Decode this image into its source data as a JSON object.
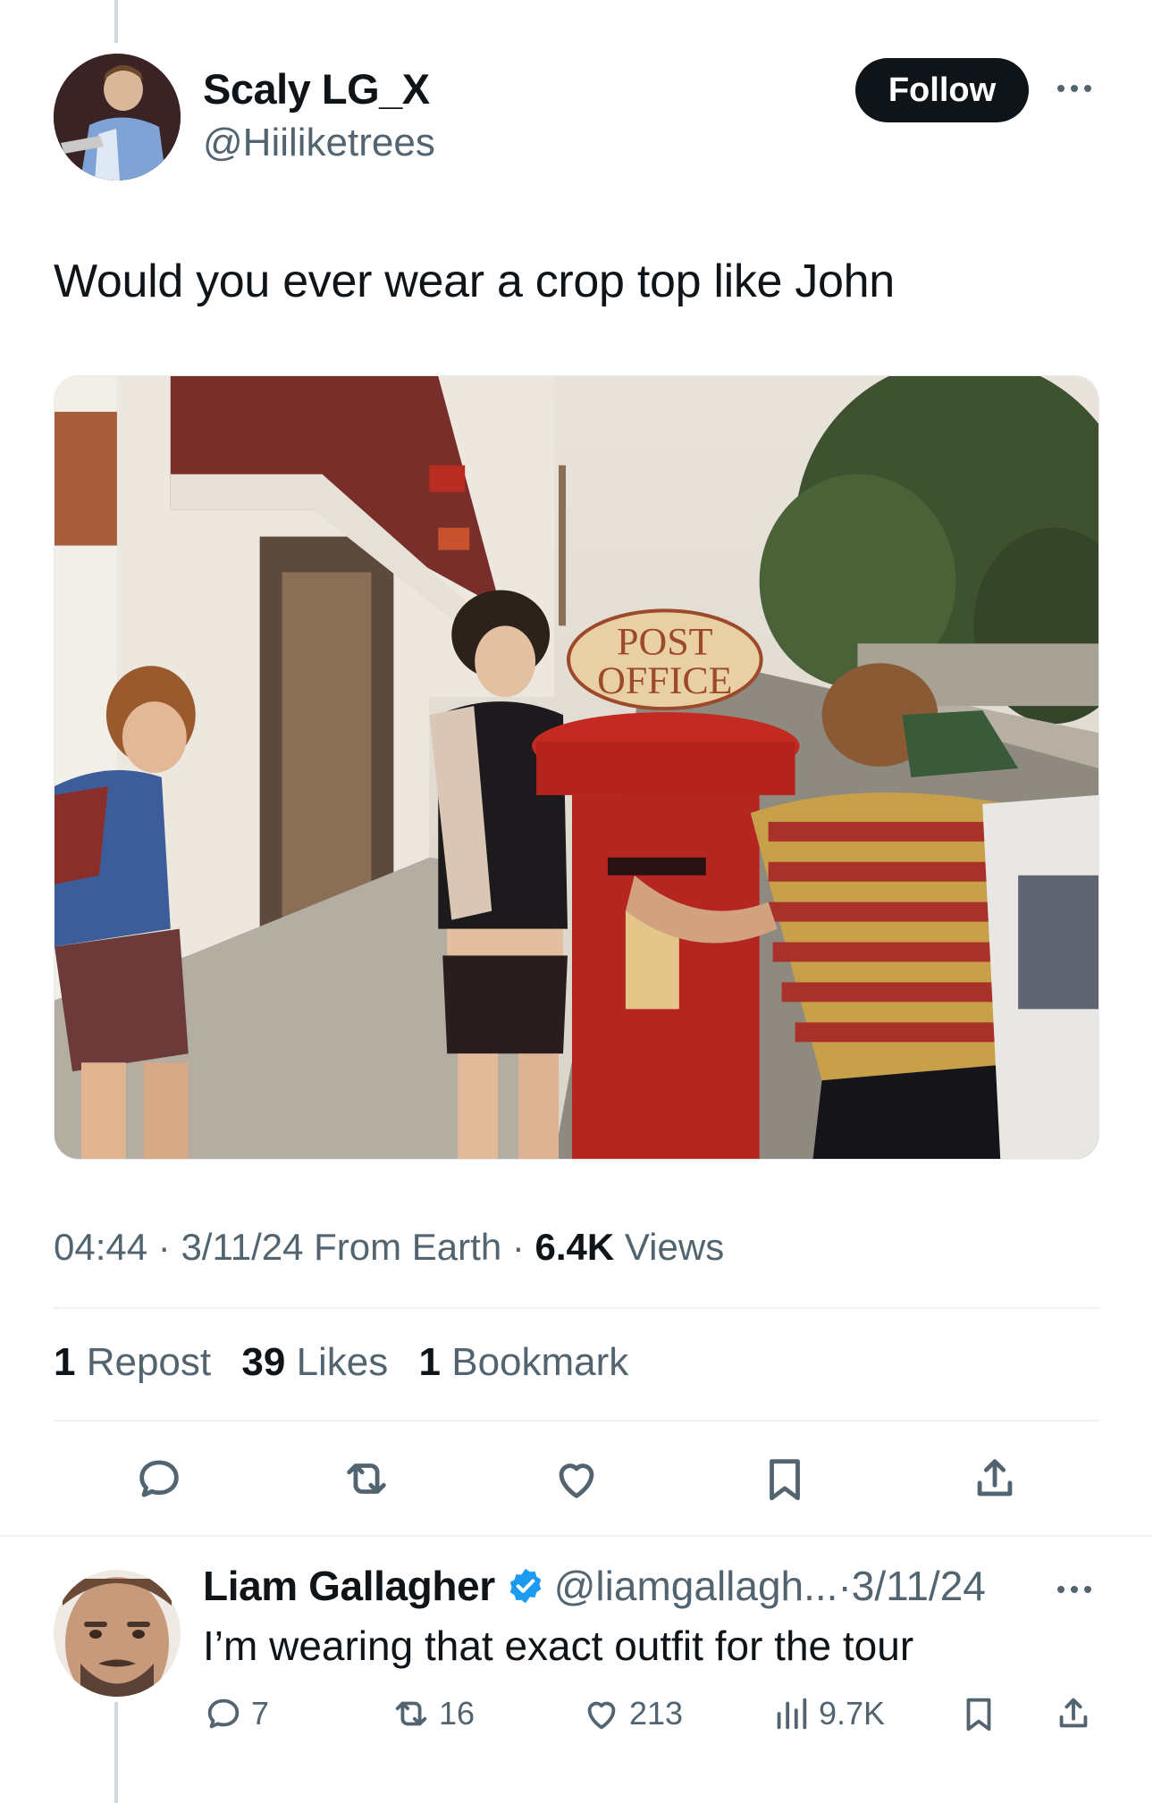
{
  "tweet": {
    "author": {
      "name": "Scaly LG_X",
      "handle": "@Hiiliketrees",
      "avatar_icon": "avatar-photo"
    },
    "follow_label": "Follow",
    "text": "Would you ever wear a crop top like John",
    "image": {
      "sign_line1": "POST",
      "sign_line2": "OFFICE"
    },
    "meta": {
      "time": "04:44",
      "dot1": "·",
      "date": "3/11/24",
      "source": "From Earth",
      "dot2": "·",
      "views_count": "6.4K",
      "views_label": "Views"
    },
    "stats": {
      "reposts_count": "1",
      "reposts_label": "Repost",
      "likes_count": "39",
      "likes_label": "Likes",
      "bookmarks_count": "1",
      "bookmarks_label": "Bookmark"
    },
    "actions": [
      "reply-icon",
      "repost-icon",
      "like-icon",
      "bookmark-icon",
      "share-icon"
    ]
  },
  "reply": {
    "name": "Liam Gallagher",
    "handle": "@liamgallagh...",
    "sep": "·",
    "date": "3/11/24",
    "text": "I’m wearing that exact outfit for the tour",
    "verified_color": "#1d9bf0",
    "counts": {
      "replies": "7",
      "reposts": "16",
      "likes": "213",
      "views": "9.7K"
    }
  },
  "colors": {
    "accent": "#1d9bf0",
    "text_primary": "#0f1419",
    "text_secondary": "#536471",
    "divider": "#eff3f4"
  }
}
